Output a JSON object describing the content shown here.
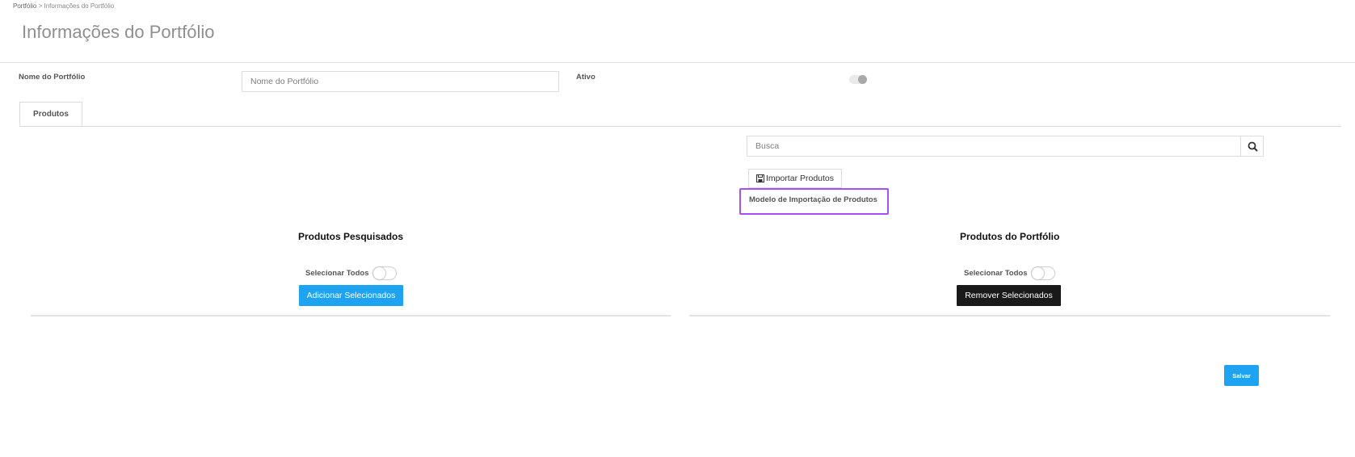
{
  "breadcrumb": {
    "root": "Portfólio",
    "separator": " > ",
    "current": "Informações do Portfólio"
  },
  "page": {
    "title": "Informações do Portfólio"
  },
  "form": {
    "name_label": "Nome do Portfólio",
    "name_placeholder": "Nome do Portfólio",
    "name_value": "",
    "active_label": "Ativo",
    "active_on": false
  },
  "tabs": [
    {
      "label": "Produtos",
      "active": true
    }
  ],
  "search": {
    "placeholder": "Busca",
    "value": "",
    "icon": "search-icon"
  },
  "import": {
    "button_label": "Importar Produtos",
    "button_icon": "save-icon",
    "template_link": "Modelo de Importação de Produtos",
    "highlight_color": "#a64ff7"
  },
  "left_panel": {
    "title": "Produtos Pesquisados",
    "select_all_label": "Selecionar Todos",
    "select_all_on": false,
    "action_label": "Adicionar Selecionados"
  },
  "right_panel": {
    "title": "Produtos do Portfólio",
    "select_all_label": "Selecionar Todos",
    "select_all_on": false,
    "action_label": "Remover Selecionados"
  },
  "footer": {
    "save_label": "Salvar"
  },
  "colors": {
    "primary": "#1ea3f2",
    "dark": "#1a1a1a",
    "highlight": "#a64ff7"
  }
}
